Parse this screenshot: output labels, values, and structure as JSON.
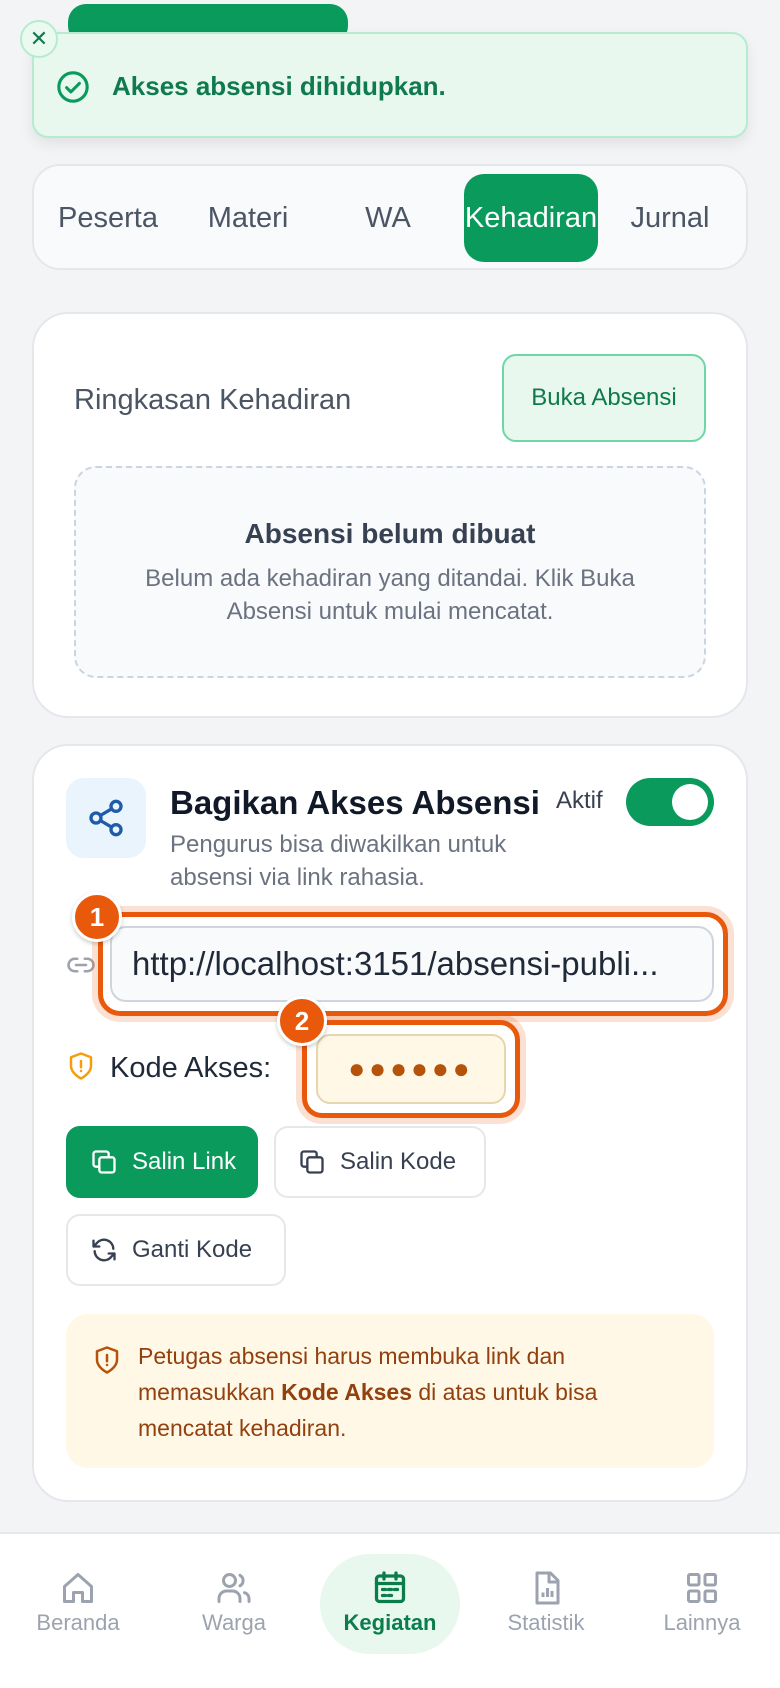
{
  "toast": {
    "message": "Akses absensi dihidupkan.",
    "close_icon": "close-icon",
    "status_icon": "check-circle-icon"
  },
  "tabs": [
    {
      "label": "Peserta",
      "active": false
    },
    {
      "label": "Materi",
      "active": false
    },
    {
      "label": "WA",
      "active": false
    },
    {
      "label": "Kehadiran",
      "active": true
    },
    {
      "label": "Jurnal",
      "active": false
    }
  ],
  "summary": {
    "title": "Ringkasan Kehadiran",
    "open_button": "Buka Absensi",
    "empty_title": "Absensi belum dibuat",
    "empty_desc": "Belum ada kehadiran yang ditandai. Klik Buka Absensi untuk mulai mencatat."
  },
  "share": {
    "title": "Bagikan Akses Absensi",
    "description": "Pengurus bisa diwakilkan untuk absensi via link rahasia.",
    "toggle_label": "Aktif",
    "toggle_on": true,
    "link_value": "http://localhost:3151/absensi-publi...",
    "code_label": "Kode Akses:",
    "code_value": "●●●●●●",
    "copy_link_button": "Salin Link",
    "copy_code_button": "Salin Kode",
    "change_code_button": "Ganti Kode",
    "info_prefix": "Petugas absensi harus membuka link dan memasukkan ",
    "info_bold": "Kode Akses",
    "info_suffix": " di atas untuk bisa mencatat kehadiran.",
    "badge_1": "1",
    "badge_2": "2"
  },
  "nav": [
    {
      "label": "Beranda",
      "icon": "home-icon",
      "active": false
    },
    {
      "label": "Warga",
      "icon": "users-icon",
      "active": false
    },
    {
      "label": "Kegiatan",
      "icon": "calendar-icon",
      "active": true
    },
    {
      "label": "Statistik",
      "icon": "chart-file-icon",
      "active": false
    },
    {
      "label": "Lainnya",
      "icon": "grid-icon",
      "active": false
    }
  ],
  "colors": {
    "primary": "#0a9a5c",
    "highlight": "#e8590c",
    "warning_bg": "#fff8e6"
  }
}
